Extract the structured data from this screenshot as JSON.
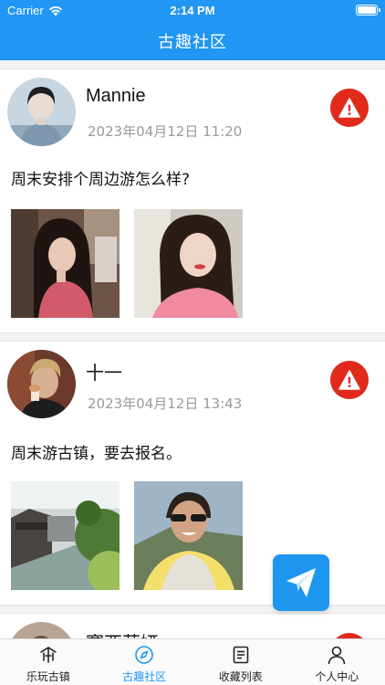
{
  "status_bar": {
    "carrier": "Carrier",
    "time": "2:14 PM"
  },
  "nav": {
    "title": "古趣社区"
  },
  "posts": [
    {
      "user": "Mannie",
      "time": "2023年04月12日 11:20",
      "text": "周末安排个周边游怎么样?",
      "photos": [
        "photo-girl-restaurant",
        "photo-girl-portrait"
      ]
    },
    {
      "user": "十一",
      "time": "2023年04月12日 13:43",
      "text": "周末游古镇，要去报名。",
      "photos": [
        "photo-canal-town",
        "photo-man-sunglasses"
      ]
    },
    {
      "user": "赛西莉娅"
    }
  ],
  "tabs": [
    {
      "label": "乐玩古镇",
      "icon": "pagoda-icon",
      "active": false
    },
    {
      "label": "古趣社区",
      "icon": "compass-icon",
      "active": true
    },
    {
      "label": "收藏列表",
      "icon": "list-document-icon",
      "active": false
    },
    {
      "label": "个人中心",
      "icon": "person-icon",
      "active": false
    }
  ],
  "colors": {
    "brand": "#2196f3",
    "report": "#e02a1c",
    "fab": "#1e96f0"
  }
}
